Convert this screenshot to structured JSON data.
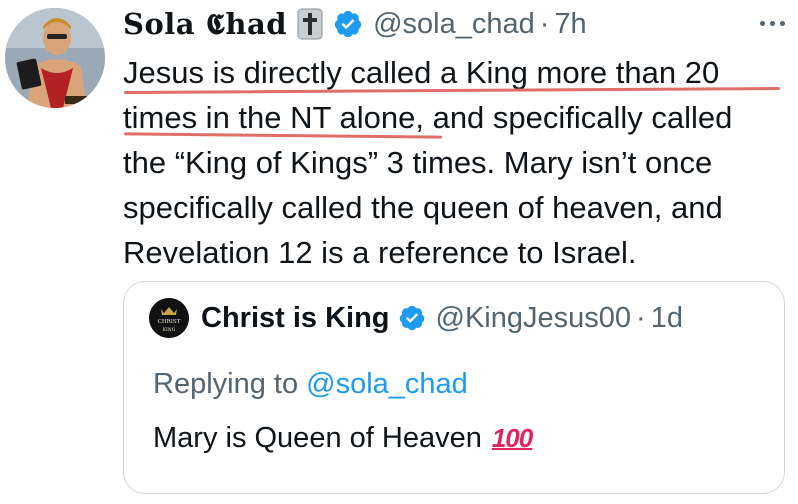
{
  "tweet": {
    "author": {
      "display_name": "Sola 𝕮had",
      "name_emoji": "cross-icon",
      "verified": true,
      "handle": "@sola_chad",
      "separator": "·",
      "time": "7h"
    },
    "more_menu": "more-options-icon",
    "text_lines": [
      "Jesus is directly called a King more than 20",
      "times in the NT alone, and specifically called",
      "the “King of Kings” 3 times. Mary isn’t once",
      "specifically called the queen of heaven, and",
      "Revelation 12 is a reference to Israel."
    ],
    "annotation_color": "#e06d68"
  },
  "quoted_tweet": {
    "author": {
      "display_name": "Christ is King",
      "verified": true,
      "handle": "@KingJesus00",
      "separator": "·",
      "time": "1d",
      "avatar_text": [
        "CHRIST",
        "KING"
      ]
    },
    "replying_prefix": "Replying to",
    "replying_handle": "@sola_chad",
    "text": "Mary is Queen of Heaven",
    "emoji": "💯"
  },
  "colors": {
    "verified_badge": "#1d9bf0",
    "secondary_text": "#536471",
    "border": "#cfd9de"
  }
}
